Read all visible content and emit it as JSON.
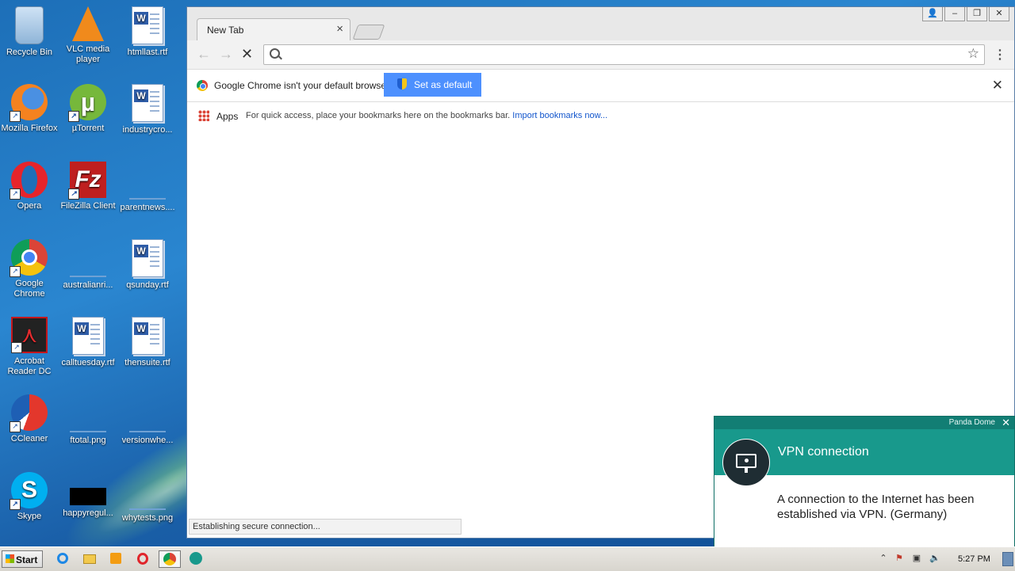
{
  "desktop": {
    "icons": [
      {
        "label": "Recycle Bin",
        "icon": "recycle-bin-icon"
      },
      {
        "label": "VLC media player",
        "icon": "vlc-icon"
      },
      {
        "label": "htmllast.rtf",
        "icon": "word-document-icon"
      },
      {
        "label": "Mozilla Firefox",
        "icon": "firefox-icon"
      },
      {
        "label": "µTorrent",
        "icon": "utorrent-icon"
      },
      {
        "label": "industrycro...",
        "icon": "word-document-icon"
      },
      {
        "label": "Opera",
        "icon": "opera-icon"
      },
      {
        "label": "FileZilla Client",
        "icon": "filezilla-icon"
      },
      {
        "label": "parentnews....",
        "icon": "blank-file-icon"
      },
      {
        "label": "Google Chrome",
        "icon": "chrome-icon"
      },
      {
        "label": "australianri...",
        "icon": "blank-file-icon"
      },
      {
        "label": "qsunday.rtf",
        "icon": "word-document-icon"
      },
      {
        "label": "Acrobat Reader DC",
        "icon": "acrobat-icon"
      },
      {
        "label": "calltuesday.rtf",
        "icon": "word-document-icon"
      },
      {
        "label": "thensuite.rtf",
        "icon": "word-document-icon"
      },
      {
        "label": "CCleaner",
        "icon": "ccleaner-icon"
      },
      {
        "label": "ftotal.png",
        "icon": "image-file-icon"
      },
      {
        "label": "versionwhe...",
        "icon": "blank-file-icon"
      },
      {
        "label": "Skype",
        "icon": "skype-icon"
      },
      {
        "label": "happyregul...",
        "icon": "image-file-icon"
      },
      {
        "label": "whytests.png",
        "icon": "image-file-icon"
      }
    ]
  },
  "browser": {
    "tab_title": "New Tab",
    "tab_close": "×",
    "omnibox": {
      "value": "",
      "placeholder": ""
    },
    "nav": {
      "back": "←",
      "forward": "→",
      "stop": "✕",
      "star": "☆",
      "menu": "⋮"
    },
    "infobar": {
      "message": "Google Chrome isn't your default browser.",
      "button": "Set as default",
      "close": "✕"
    },
    "bookmarks": {
      "apps": "Apps",
      "hint": "For quick access, place your bookmarks here on the bookmarks bar.",
      "import": "Import bookmarks now..."
    },
    "status": "Establishing secure connection..."
  },
  "panda_popup": {
    "brand": "Panda Dome",
    "close": "✕",
    "title": "VPN connection",
    "body": "A connection to the Internet has been established via VPN. (Germany)",
    "accent_color": "#18998c"
  },
  "taskbar": {
    "start_label": "Start",
    "clock": "5:27 PM"
  }
}
